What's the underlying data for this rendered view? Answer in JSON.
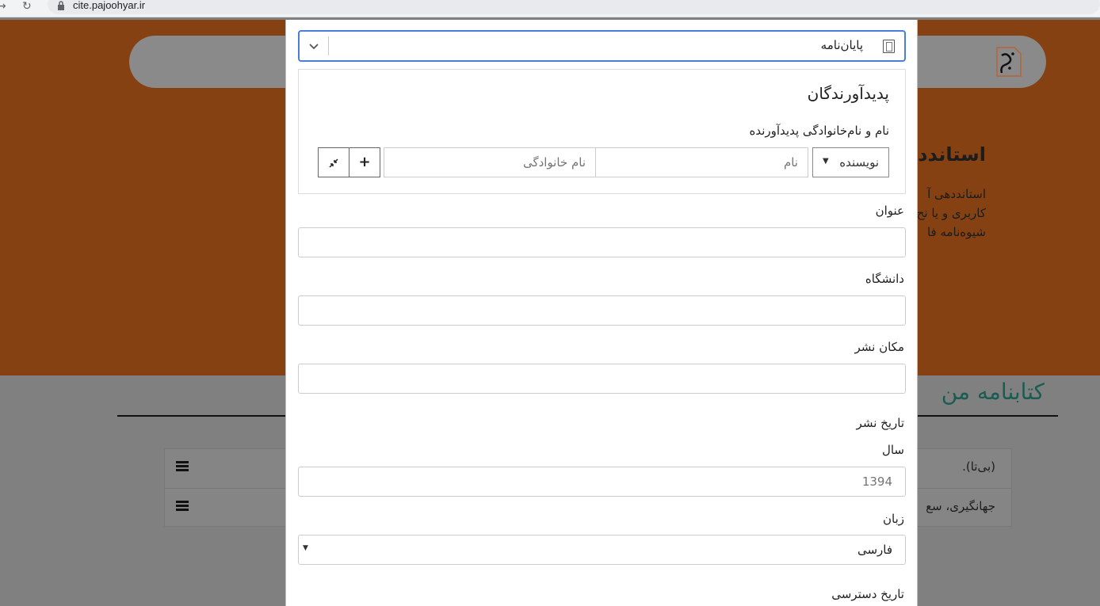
{
  "browser": {
    "url": "cite.pajoohyar.ir"
  },
  "background": {
    "hero_title": "استاندده",
    "hero_lines": [
      "استانددهی آ",
      "کاربری و یا نح",
      "شیوه‌نامه فا"
    ],
    "bibliography_title": "کتابنامه من",
    "rows": [
      {
        "text": "(بی‌تا)."
      },
      {
        "text": "جهانگیری، سع"
      }
    ],
    "colors": {
      "hero": "#854112",
      "accent": "#1b5c52"
    }
  },
  "modal": {
    "type_select": {
      "value": "پایان‌نامه",
      "icon": "document-icon"
    },
    "creators": {
      "heading": "پدیدآورندگان",
      "sublabel": "نام و نام‌خانوادگی پدیدآورنده",
      "role": "نویسنده",
      "first_name_placeholder": "نام",
      "last_name_placeholder": "نام خانوادگی",
      "add_icon": "plus-icon",
      "collapse_icon": "minimize-icon"
    },
    "fields": {
      "title_label": "عنوان",
      "university_label": "دانشگاه",
      "place_label": "مکان نشر",
      "date_label": "تاریخ نشر",
      "year_label": "سال",
      "year_value": "1394",
      "language_label": "زبان",
      "language_value": "فارسی",
      "access_date_label": "تاریخ دسترسی"
    },
    "accent_color": "#4a7fd4"
  }
}
